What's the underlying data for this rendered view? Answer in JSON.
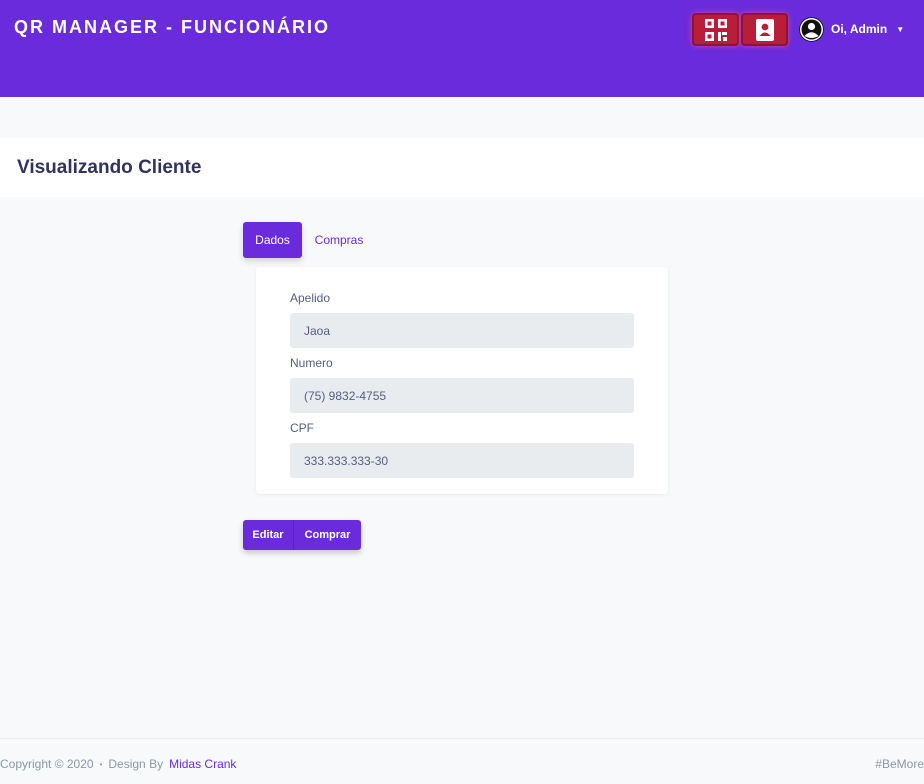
{
  "header": {
    "brand": "QR MANAGER - FUNCIONÁRIO",
    "qr_button_icon": "qr-code-icon",
    "contacts_button_icon": "address-book-icon",
    "user_greeting": "Oi, Admin",
    "accent_color": "#6a2bdc",
    "alert_button_color": "#b81e3a"
  },
  "page": {
    "title": "Visualizando Cliente"
  },
  "tabs": [
    {
      "label": "Dados",
      "active": true
    },
    {
      "label": "Compras",
      "active": false
    }
  ],
  "form": {
    "fields": [
      {
        "label": "Apelido",
        "value": "Jaoa"
      },
      {
        "label": "Numero",
        "value": "(75) 9832-4755"
      },
      {
        "label": "CPF",
        "value": "333.333.333-30"
      }
    ]
  },
  "actions": {
    "edit_label": "Editar",
    "buy_label": "Comprar"
  },
  "footer": {
    "copyright": "Copyright © 2020",
    "separator": "•",
    "design_by": "Design By",
    "designer": "Midas Crank",
    "hashtag": "#BeMore"
  }
}
